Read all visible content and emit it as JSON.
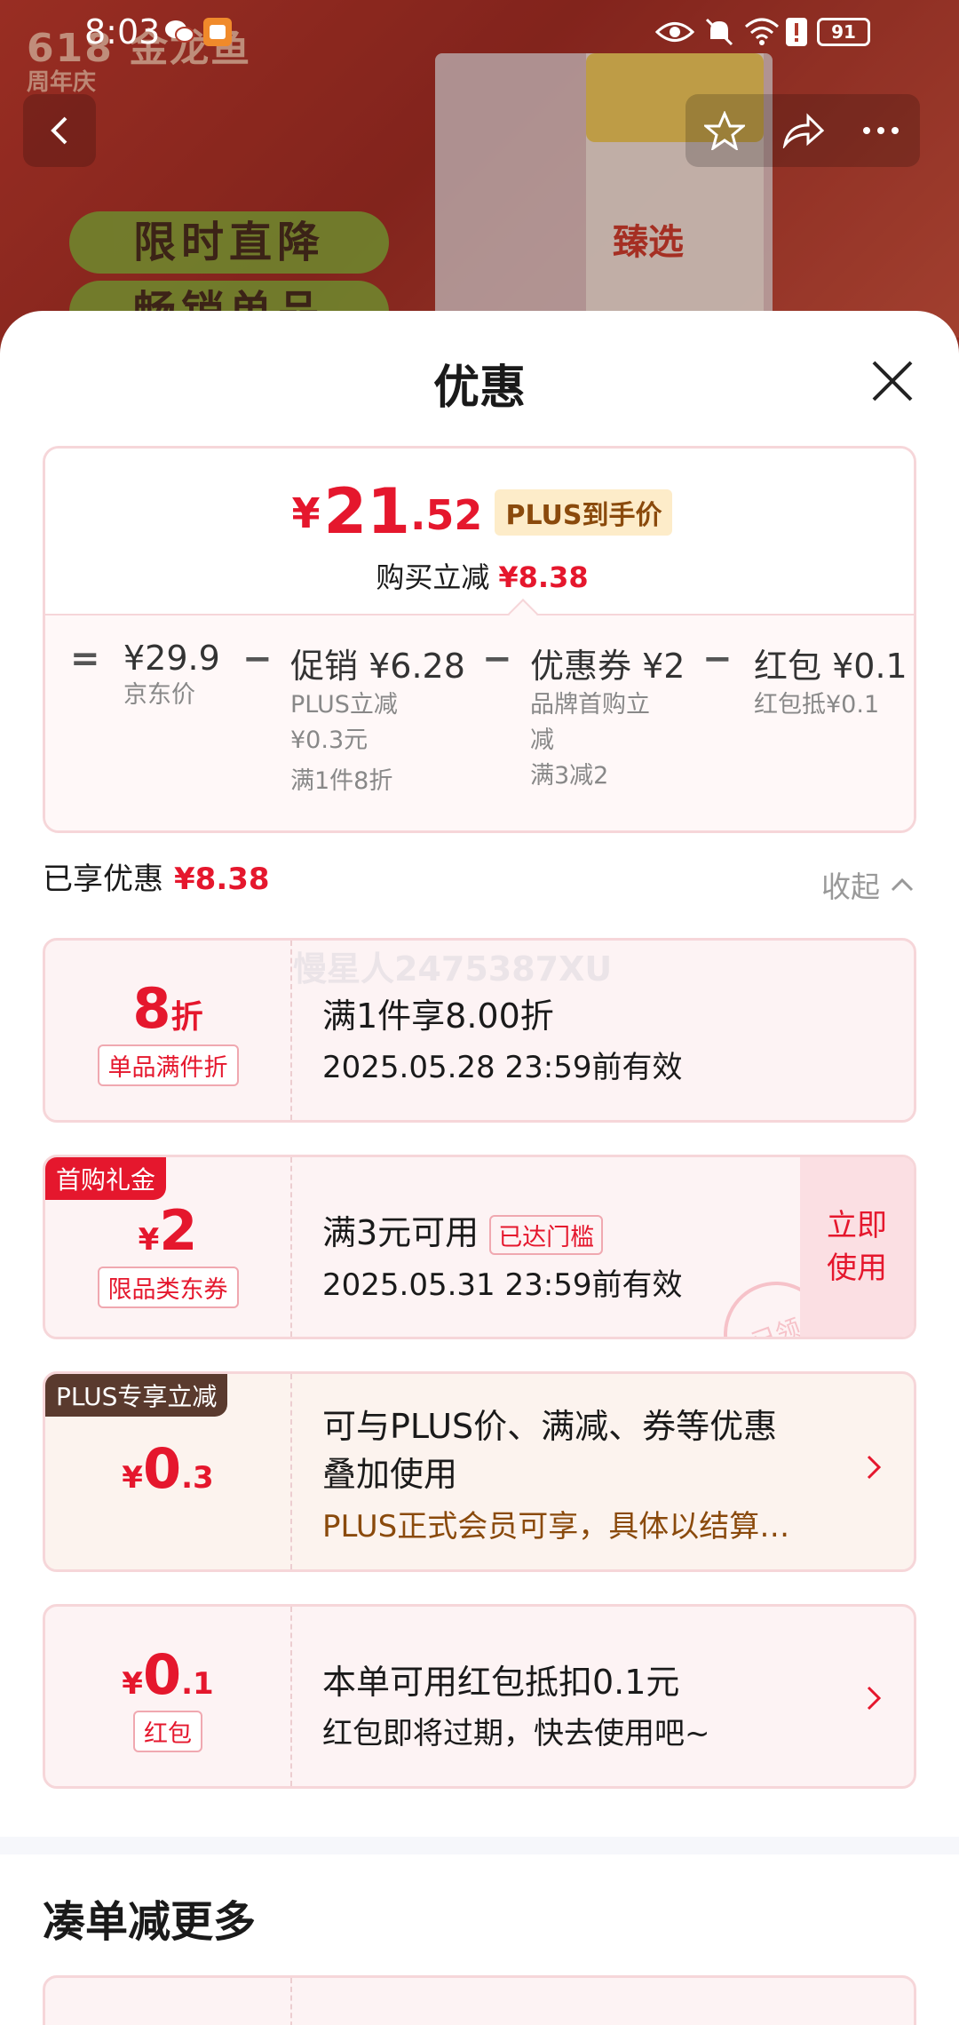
{
  "status_bar": {
    "time": "8:03",
    "battery": "91"
  },
  "banner": {
    "brand": "金龙鱼",
    "brand_sub": "周年庆",
    "anniv": "618",
    "pill_1": "限时直降",
    "pill_2": "畅销单品",
    "package_text": "臻选"
  },
  "sheet": {
    "title": "优惠",
    "summary": {
      "price_symbol": "¥",
      "price_int": "21",
      "price_dec": ".52",
      "plus_tag": "PLUS到手价",
      "saving_label": "购买立减",
      "saving_value": "¥8.38",
      "breakdown": {
        "eq": "=",
        "jd_price": "¥29.9",
        "jd_price_label": "京东价",
        "minus": "−",
        "promo_label": "促销",
        "promo_value": "¥6.28",
        "promo_sub_1": "PLUS立减",
        "promo_sub_2": "¥0.3元",
        "promo_sub_3": "满1件8折",
        "coupon_label": "优惠券",
        "coupon_value": "¥2",
        "coupon_sub_1": "品牌首购立",
        "coupon_sub_2": "减",
        "coupon_sub_3": "满3减2",
        "redpack_label": "红包",
        "redpack_value": "¥0.1",
        "redpack_sub": "红包抵¥0.1"
      }
    },
    "enjoyed_label": "已享优惠",
    "enjoyed_value": "¥8.38",
    "collapse_label": "收起",
    "watermark": "慢星人2475387XU",
    "coupons": [
      {
        "value": "8",
        "unit": "折",
        "badge": "单品满件折",
        "line1": "满1件享8.00折",
        "line2": "2025.05.28 23:59前有效"
      },
      {
        "corner": "首购礼金",
        "symbol": "¥",
        "value": "2",
        "badge": "限品类东券",
        "line1": "满3元可用",
        "threshold": "已达门槛",
        "line2": "2025.05.31 23:59前有效",
        "action_1": "立即",
        "action_2": "使用",
        "stamp": "已领"
      },
      {
        "corner": "PLUS专享立减",
        "symbol": "¥",
        "value": "0",
        "dec": ".3",
        "line1": "可与PLUS价、满减、券等优惠",
        "line1b": "叠加使用",
        "line2": "PLUS正式会员可享，具体以结算…"
      },
      {
        "symbol": "¥",
        "value": "0",
        "dec": ".1",
        "badge": "红包",
        "line1": "本单可用红包抵扣0.1元",
        "line2": "红包即将过期，快去使用吧~"
      }
    ],
    "more_section_title": "凑单减更多"
  },
  "colors": {
    "accent_red": "#e5172d",
    "plus_gold": "#8a4a0c",
    "card_border": "#f6d6d9"
  }
}
